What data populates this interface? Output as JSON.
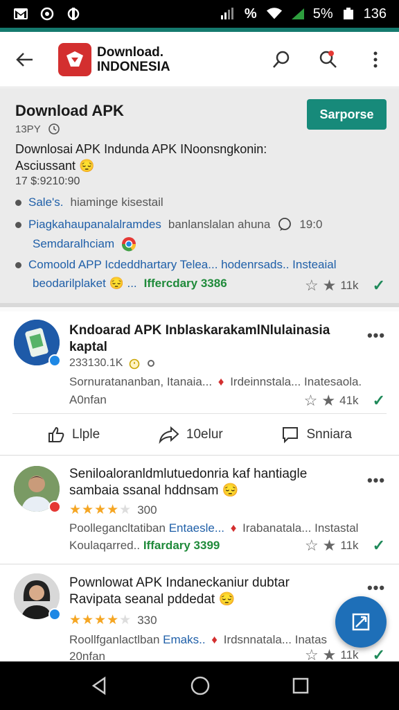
{
  "status": {
    "battery": "5%",
    "time": "136"
  },
  "header": {
    "brand_line1": "Download.",
    "brand_line2": "INDONESIA"
  },
  "banner": {
    "title": "Download APK",
    "button": "Sarporse",
    "sub": "13PY",
    "desc": "Downlosai APK Indunda APK INoonsngkonin: Asciussant 😔",
    "price": "17 $:9210:90",
    "b1_a": "Sale's.",
    "b1_b": "hiaminge kisestail",
    "b2_a": "Piagkahaupanalalramdes",
    "b2_b": "banlanslalan ahuna",
    "b2_c": "19:0",
    "b2_line2": "Semdaralhciam",
    "b3_line1": "Comoold APP Icdeddhartary Telea... hodenrsads.. Insteaial",
    "b3_line2a": "beodarilplaket 😔 ...",
    "b3_line2b": "Iffercdary 3386",
    "rating": "11k"
  },
  "post1": {
    "title": "Kndoarad APK Inblaskarakaml​Nlulainasia kaptal",
    "meta": "233130.1K",
    "line1a": "Sornuratananban, Itanaia...",
    "line1b": "Irdeinnstala... Inatesaola.",
    "line2": "A0nfan",
    "rating": "41k",
    "like": "Llple",
    "share": "10elur",
    "comment": "Snniara"
  },
  "post2": {
    "title": "Seniloaloranldmlutuedonria kaf hantiagle sambaia ssanal hddnsam 😔",
    "count": "300",
    "line1a": "Poollegancltatiban",
    "line1b": "Entaesle...",
    "line1c": "Irabanatala... Instastal",
    "line2a": "Koulaqarred..",
    "line2b": "Iffardary 3399",
    "rating": "11k"
  },
  "post3": {
    "title": "Pownlowat APK Indaneckaniur dubtar Ravipata seanal pddedat 😔",
    "count": "330",
    "line1a": "Roollfganlactlban",
    "line1b": "Emaks..",
    "line1c": "Irdsnnatala... Inatas",
    "line2": "20nfan",
    "rating": "11k"
  },
  "colors": {
    "accent": "#178a7a",
    "brand": "#d32f2f",
    "fab": "#1e6fb8"
  }
}
